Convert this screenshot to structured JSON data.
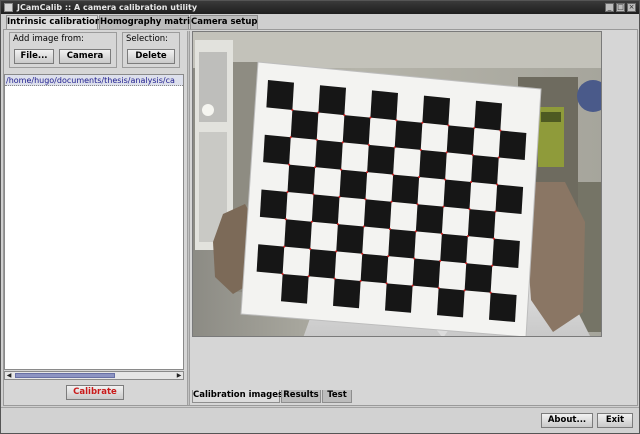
{
  "window": {
    "title": "JCamCalib :: A camera calibration utility",
    "controls": [
      "minimize-icon",
      "maximize-icon",
      "close-icon"
    ]
  },
  "tabs": [
    {
      "label": "Intrinsic calibration",
      "active": true
    },
    {
      "label": "Homography matrix",
      "active": false
    },
    {
      "label": "Camera setup",
      "active": false
    }
  ],
  "left": {
    "add_image": {
      "title": "Add image from:",
      "file_label": "File...",
      "camera_label": "Camera"
    },
    "selection": {
      "title": "Selection:",
      "delete_label": "Delete"
    },
    "image_list": [
      "/home/hugo/documents/thesis/analysis/ca"
    ],
    "calibrate_label": "Calibrate"
  },
  "right": {
    "image": {
      "subject": "checkerboard calibration pattern held by hands",
      "grid_cols": 10,
      "grid_rows": 8
    },
    "bottom_tabs": [
      {
        "label": "Calibration images",
        "active": true
      },
      {
        "label": "Results",
        "active": false
      },
      {
        "label": "Test",
        "active": false
      }
    ]
  },
  "footer": {
    "about_label": "About...",
    "exit_label": "Exit"
  },
  "colors": {
    "titlebar": "#262626",
    "selection_text": "#1c1a8c",
    "calibrate_text": "#c91a1a",
    "scroll_thumb": "#8d94c2"
  }
}
